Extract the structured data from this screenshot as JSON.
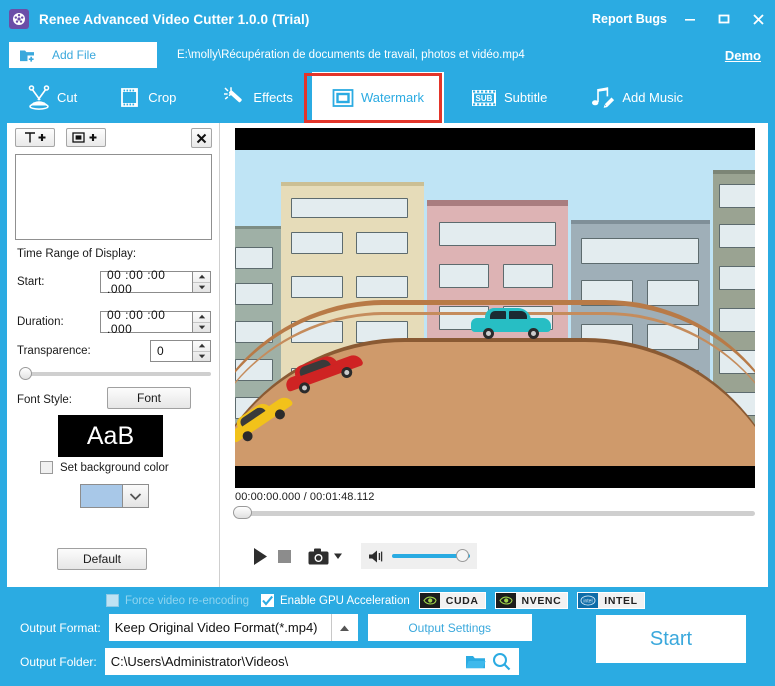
{
  "window": {
    "title": "Renee Advanced Video Cutter 1.0.0 (Trial)",
    "app_icon": "film-reel-icon",
    "report_bugs": "Report Bugs",
    "minimize": "minimize-icon",
    "maximize": "maximize-icon",
    "close": "close-icon",
    "accent_color": "#2BABE2",
    "highlight_color": "#e3352a"
  },
  "filebar": {
    "add_file_label": "Add File",
    "file_path": "E:\\molly\\Récupération de documents de travail, photos et vidéo.mp4",
    "demo_label": "Demo"
  },
  "tabs": [
    {
      "id": "cut",
      "label": "Cut",
      "icon": "scissors-icon",
      "active": false
    },
    {
      "id": "crop",
      "label": "Crop",
      "icon": "film-frame-icon",
      "active": false
    },
    {
      "id": "effects",
      "label": "Effects",
      "icon": "magic-wand-icon",
      "active": false
    },
    {
      "id": "watermark",
      "label": "Watermark",
      "icon": "watermark-square-icon",
      "active": true
    },
    {
      "id": "subtitle",
      "label": "Subtitle",
      "icon": "sub-film-icon",
      "active": false
    },
    {
      "id": "music",
      "label": "Add Music",
      "icon": "music-note-pencil-icon",
      "active": false
    }
  ],
  "watermark_panel": {
    "add_text_label": "T +",
    "add_image_label": "▣ +",
    "close_label": "✕",
    "list_items": [],
    "time_range_label": "Time Range of Display:",
    "start_label": "Start:",
    "start_value": "00 :00 :00 .000",
    "duration_label": "Duration:",
    "duration_value": "00 :00 :00 .000",
    "transparence_label": "Transparence:",
    "transparence_value": "0",
    "transparence_slider_pct": 0,
    "font_style_label": "Font Style:",
    "font_button_label": "Font",
    "font_preview_text": "AaB",
    "font_preview_bg": "#000000",
    "set_background_label": "Set background color",
    "set_background_checked": false,
    "background_color": "#a8c8e8",
    "default_button_label": "Default"
  },
  "player": {
    "current_time": "00:00:00.000",
    "total_time": "00:01:48.112",
    "time_display": "00:00:00.000 / 00:01:48.112",
    "seek_pct": 0,
    "play_icon": "play-icon",
    "stop_icon": "stop-icon",
    "snapshot_icon": "camera-icon",
    "snapshot_dropdown_icon": "caret-down-icon",
    "volume_icon": "speaker-icon",
    "volume_pct": 82
  },
  "preview": {
    "description": "Cartoon cityscape with arched bridge and cars",
    "sky_color": "#bfe4f5",
    "bridge_color": "#cf9a6b",
    "cars": [
      {
        "name": "teal-car",
        "color": "#27bec4"
      },
      {
        "name": "red-car",
        "color": "#cf2323"
      },
      {
        "name": "yellow-car",
        "color": "#f2c21a"
      }
    ],
    "buildings": [
      {
        "name": "building-left-grey",
        "color": "#9fb0a6"
      },
      {
        "name": "building-beige",
        "color": "#e6dcb9"
      },
      {
        "name": "building-pink",
        "color": "#ddb3b4"
      },
      {
        "name": "building-blue-grey",
        "color": "#9fafb8"
      },
      {
        "name": "building-right-olive",
        "color": "#9aa392"
      }
    ]
  },
  "bottom": {
    "force_reencode_label": "Force video re-encoding",
    "force_reencode_checked": false,
    "gpu_accel_label": "Enable GPU Acceleration",
    "gpu_accel_checked": true,
    "gpu_badges": [
      {
        "name": "cuda",
        "label": "CUDA",
        "icon": "nvidia-eye-icon"
      },
      {
        "name": "nvenc",
        "label": "NVENC",
        "icon": "nvidia-eye-icon"
      },
      {
        "name": "intel",
        "label": "INTEL",
        "icon": "intel-logo-icon"
      }
    ],
    "output_format_label": "Output Format:",
    "output_format_value": "Keep Original Video Format(*.mp4)",
    "output_format_arrow": "caret-up-icon",
    "output_settings_label": "Output Settings",
    "output_folder_label": "Output Folder:",
    "output_folder_value": "C:\\Users\\Administrator\\Videos\\",
    "folder_icon": "folder-icon",
    "search_icon": "magnifier-icon",
    "start_label": "Start"
  }
}
